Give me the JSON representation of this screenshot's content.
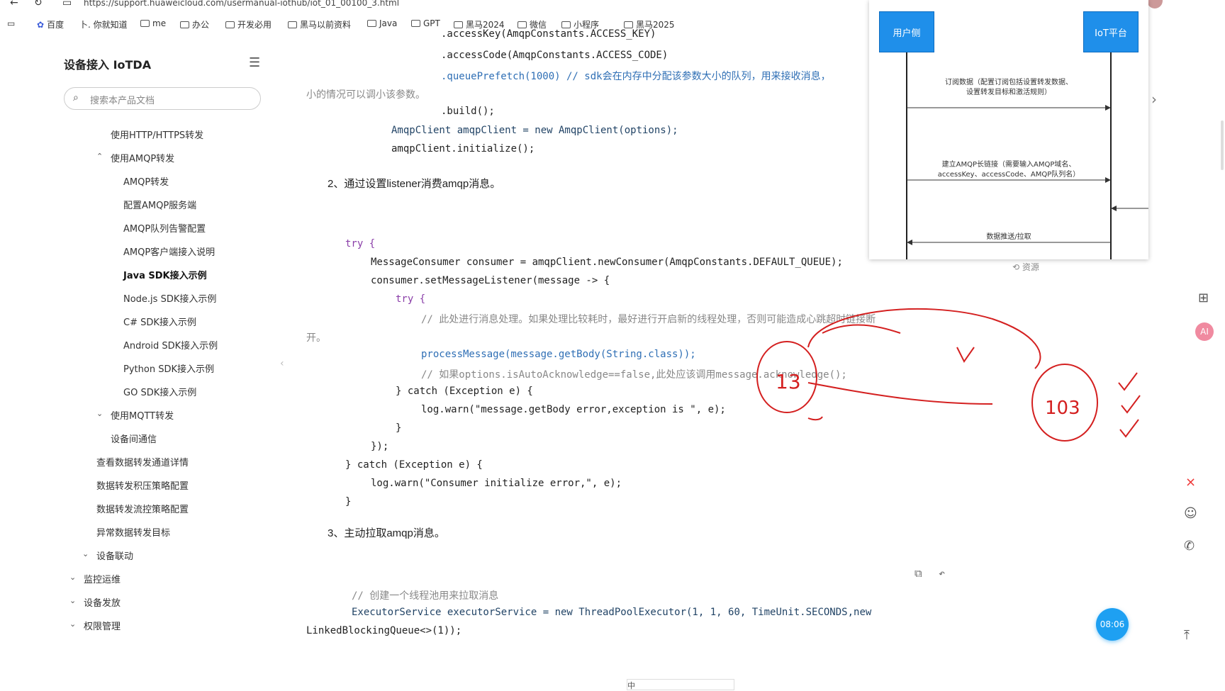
{
  "browser": {
    "url": "https://support.huaweicloud.com/usermanual-iothub/iot_01_00100_3.html",
    "bookmarks": [
      "百度",
      "卜. 你就知道",
      "me",
      "办公",
      "开发必用",
      "黑马以前资料",
      "Java",
      "GPT",
      "黑马2024",
      "微信",
      "小程序",
      "黑马2025"
    ]
  },
  "sidebar": {
    "title": "设备接入 IoTDA",
    "search_placeholder": "搜索本产品文档",
    "items": [
      {
        "label": "使用HTTP/HTTPS转发"
      },
      {
        "label": "使用AMQP转发",
        "chevron": "^"
      },
      {
        "label": "AMQP转发"
      },
      {
        "label": "配置AMQP服务端"
      },
      {
        "label": "AMQP队列告警配置"
      },
      {
        "label": "AMQP客户端接入说明"
      },
      {
        "label": "Java SDK接入示例",
        "active": true
      },
      {
        "label": "Node.js SDK接入示例"
      },
      {
        "label": "C# SDK接入示例"
      },
      {
        "label": "Android SDK接入示例"
      },
      {
        "label": "Python SDK接入示例"
      },
      {
        "label": "GO SDK接入示例"
      },
      {
        "label": "使用MQTT转发",
        "chevron": "v"
      },
      {
        "label": "设备间通信"
      },
      {
        "label": "查看数据转发通道详情"
      },
      {
        "label": "数据转发积压策略配置"
      },
      {
        "label": "数据转发流控策略配置"
      },
      {
        "label": "异常数据转发目标"
      },
      {
        "label": "设备联动",
        "chevron": "v"
      },
      {
        "label": "监控运维",
        "chevron": "v"
      },
      {
        "label": "设备发放",
        "chevron": "v"
      },
      {
        "label": "权限管理",
        "chevron": "v"
      }
    ]
  },
  "content": {
    "heading2": "2、通过设置listener消费amqp消息。",
    "heading3": "3、主动拉取amqp消息。",
    "block1": [
      ".accessKey(AmqpConstants.ACCESS_KEY)",
      ".accessCode(AmqpConstants.ACCESS_CODE)",
      ".queuePrefetch(1000) // sdk会在内存中分配该参数大小的队列，用来接收消息，",
      "小的情况可以调小该参数。",
      ".build();",
      "AmqpClient amqpClient = new AmqpClient(options);",
      "amqpClient.initialize();"
    ],
    "block2": [
      "try {",
      "MessageConsumer consumer = amqpClient.newConsumer(AmqpConstants.DEFAULT_QUEUE);",
      "consumer.setMessageListener(message -> {",
      "try {",
      "// 此处进行消息处理。如果处理比较耗时，最好进行开启新的线程处理，否则可能造成心跳超时链接断",
      "开。",
      "processMessage(message.getBody(String.class));",
      "// 如果options.isAutoAcknowledge==false,此处应该调用message.acknowledge();",
      "} catch (Exception e) {",
      "log.warn(\"message.getBody error,exception is \", e);",
      "}",
      "});",
      "} catch (Exception e) {",
      "log.warn(\"Consumer initialize error,\", e);",
      "}"
    ],
    "block3": [
      "// 创建一个线程池用来拉取消息",
      "ExecutorService executorService = new ThreadPoolExecutor(1, 1, 60, TimeUnit.SECONDS,new",
      "LinkedBlockingQueue<>(1));"
    ]
  },
  "diagram": {
    "left_lane": "用户侧",
    "right_lane": "IoT平台",
    "msg1": "订阅数据（配置订阅包括设置转发数据、\n设置转发目标和激活规则）",
    "msg2": "建立AMQP长链接（需要输入AMQP域名、\naccessKey、accessCode、AMQP队列名）",
    "msg3": "数据推送/拉取",
    "resource_label": "资源"
  },
  "annotations": {
    "left_number": "13",
    "right_number": "103"
  },
  "timer": "08:06",
  "ime": "中"
}
